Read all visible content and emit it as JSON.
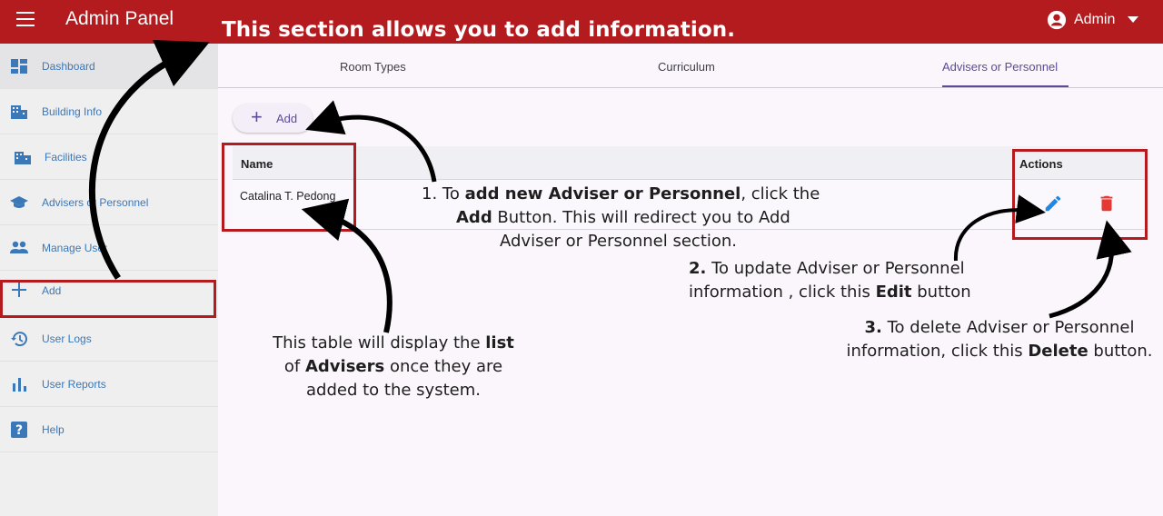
{
  "app": {
    "title": "Admin Panel",
    "user": "Admin"
  },
  "banner": "This section allows you to add information.",
  "sidebar": {
    "items": [
      {
        "label": "Dashboard",
        "icon": "dashboard-icon"
      },
      {
        "label": "Building Info",
        "icon": "building-icon"
      },
      {
        "label": "Facilities",
        "icon": "facilities-icon"
      },
      {
        "label": "Advisers or Personnel",
        "icon": "school-cap-icon"
      },
      {
        "label": "Manage User",
        "icon": "people-icon"
      },
      {
        "label": "Add",
        "icon": "plus-icon"
      },
      {
        "label": "User Logs",
        "icon": "history-icon"
      },
      {
        "label": "User Reports",
        "icon": "bar-chart-icon"
      },
      {
        "label": "Help",
        "icon": "help-icon"
      }
    ]
  },
  "tabs": [
    {
      "label": "Room Types"
    },
    {
      "label": "Curriculum"
    },
    {
      "label": "Advisers or Personnel",
      "active": true
    }
  ],
  "add_button": {
    "label": "Add"
  },
  "table": {
    "columns": [
      "Name",
      "Actions"
    ],
    "rows": [
      {
        "name": "Catalina T. Pedong"
      }
    ]
  },
  "notes": {
    "n1": {
      "prefix": "1. To ",
      "bold1": "add new Adviser or Personnel",
      "mid1": ", click the",
      "bold2": "Add",
      "mid2": " Button. This will redirect you to Add",
      "line3": "Adviser or Personnel section."
    },
    "n2": {
      "num": "2.",
      "line1": " To update Adviser or Personnel",
      "line2a": "information , click this ",
      "bold": "Edit",
      "line2b": " button"
    },
    "n3": {
      "num": "3.",
      "line1": " To delete Adviser or Personnel",
      "line2a": "information,  click this ",
      "bold": "Delete",
      "line2b": " button."
    },
    "table_note": {
      "a": "This table will display the ",
      "b1": "list",
      "c": "of ",
      "b2": "Advisers",
      "d": " once they are",
      "e": "added to the system."
    }
  },
  "colors": {
    "topbar": "#b31b1f",
    "accent": "#5a4c96",
    "edit": "#1e88e5",
    "delete": "#e53935",
    "sidebar_link": "#3a78b8"
  }
}
